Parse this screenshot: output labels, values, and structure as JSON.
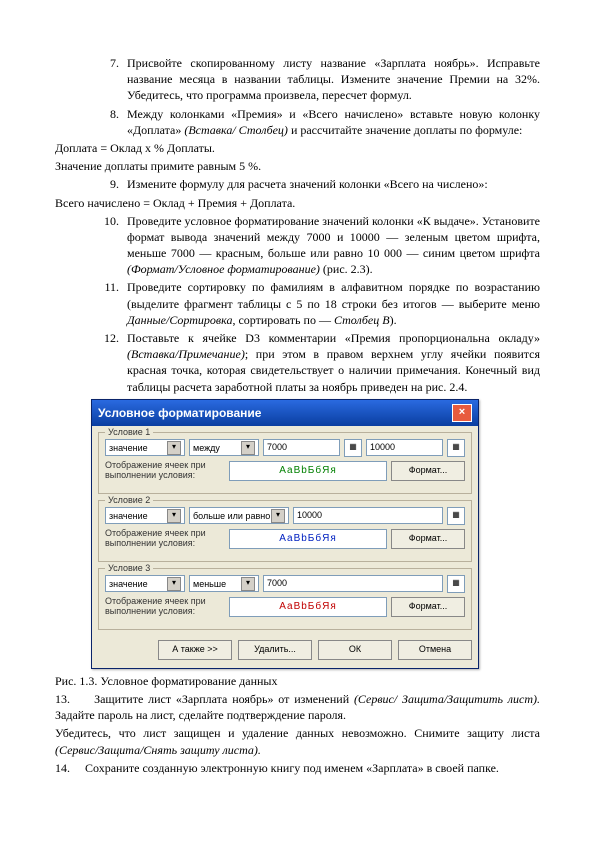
{
  "items": {
    "i7": {
      "num": "7.",
      "text": "Присвойте скопированному листу название «Зарплата ноябрь». Исправьте название месяца в названии таблицы. Измените значение Премии на 32%. Убедитесь, что программа произвела, пересчет формул."
    },
    "i8": {
      "num": "8.",
      "line1": "Между колонками «Премия» и «Всего начислено» вставьте новую колонку «Доплата» ",
      "ital1": "(Вставка/ Столбец)",
      "line2": " и рассчитайте значение доплаты по формуле:"
    },
    "p_dop": "Доплата = Оклад х % Доплаты.",
    "p_val": "Значение доплаты примите равным 5 %.",
    "i9": {
      "num": "9.",
      "text": "Измените      формулу      для      расчета      значений      колонки      «Всего      на числено»:"
    },
    "p_vsego": "Всего начислено = Оклад + Премия + Доплата.",
    "i10": {
      "num": "10.",
      "text1": "Проведите условное форматирование значений колонки «К выдаче». Установите формат вывода значений между 7000 и 10000 — зеленым цветом шрифта, меньше 7000 — красным, больше или равно 10 000 — синим цветом шрифта ",
      "ital": "(Формат/Условное форматирование)",
      "text2": " (рис. 2.3)."
    },
    "i11": {
      "num": "11.",
      "text1": "Проведите сортировку по фамилиям в алфавитном порядке по возрастанию (выделите фрагмент таблицы с 5 по 18 строки без итогов — выберите меню ",
      "ital1": "Данные/Сортировка",
      "text2": ", сортировать по — ",
      "ital2": "Столбец В",
      "text3": ")."
    },
    "i12": {
      "num": "12.",
      "text1": "Поставьте   к   ячейке   D3   комментарии   «Премия   пропорциональна   окладу»   ",
      "ital": "(Вставка/Примечание)",
      "text2": "; при этом в правом верхнем углу ячейки появится красная точка, которая свидетельствует о наличии примечания. Конечный вид таблицы расчета заработной платы за ноябрь приведен на рис. 2.4."
    },
    "i13": {
      "num": "13.",
      "text1": "Защитите      лист      «Зарплата      ноябрь»      от      изменений      ",
      "ital1": "(Сервис/ Защита/Защитить лист).",
      "text2": " Задайте пароль на лист, сделайте подтверждение пароля."
    },
    "p_check": {
      "text1": "Убедитесь, что лист защищен и удаление данных невозможно. Снимите защиту листа ",
      "ital": "(Сервис/Защита/Снять защиту листа)."
    },
    "i14": {
      "num": "14.",
      "text": "Сохраните созданную электронную книгу под именем «Зарплата» в своей папке."
    }
  },
  "caption": "Рис. 1.3. Условное форматирование данных",
  "dialog": {
    "title": "Условное форматирование",
    "close": "×",
    "s1": {
      "label": "Условие 1",
      "c1": "значение",
      "c2": "между",
      "v1": "7000",
      "v2": "10000",
      "plabel": "Отображение ячеек при выполнении условия:",
      "preview": "АаВbБбЯя",
      "btn": "Формат..."
    },
    "s2": {
      "label": "Условие 2",
      "c1": "значение",
      "c2": "больше или равно",
      "v1": "10000",
      "plabel": "Отображение ячеек при выполнении условия:",
      "preview": "АаВbБбЯя",
      "btn": "Формат..."
    },
    "s3": {
      "label": "Условие 3",
      "c1": "значение",
      "c2": "меньше",
      "v1": "7000",
      "plabel": "Отображение ячеек при выполнении условия:",
      "preview": "АаВbБбЯя",
      "btn": "Формат..."
    },
    "buttons": {
      "add": "А также >>",
      "del": "Удалить...",
      "ok": "ОК",
      "cancel": "Отмена"
    }
  }
}
